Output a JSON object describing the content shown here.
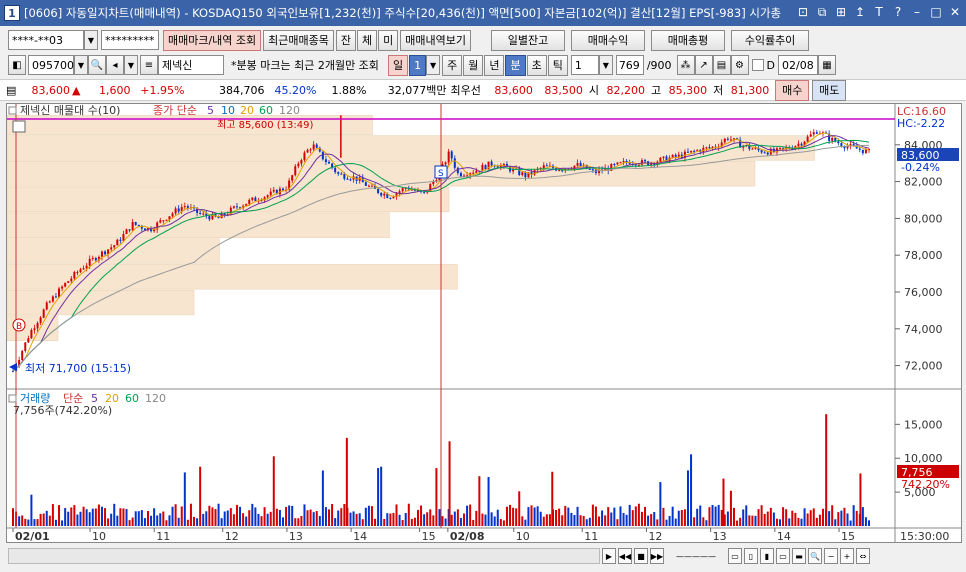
{
  "window": {
    "icon_label": "1",
    "title": "[0606] 자동일지차트(매매내역) - KOSDAQ150 외국인보유[1,232(천)] 주식수[20,436(천)] 액면[500] 자본금[102(억)] 결산[12월] EPS[-983] 시가총"
  },
  "toolbar1": {
    "account_value": "****-**03",
    "password_value": "*********",
    "trade_mark_btn": "매매마크/내역 조회",
    "recent_btn": "최근매매종목",
    "remain_btn": "잔",
    "exec_btn": "체",
    "pending_btn": "미",
    "history_btn": "매매내역보기",
    "daily_balance_btn": "일별잔고",
    "trade_profit_btn": "매매수익",
    "trade_eval_btn": "매매총평",
    "return_trend_btn": "수익률추이"
  },
  "toolbar2": {
    "code_value": "095700",
    "stock_name": "제넥신",
    "note": "*분봉 마크는 최근 2개월만 조회",
    "period_day": "일",
    "period_num": "1",
    "period_week": "주",
    "period_month": "월",
    "period_year": "년",
    "period_min": "분",
    "period_sec": "초",
    "period_tick": "틱",
    "interval_value": "1",
    "count_value": "769",
    "count_total": "/900",
    "date_label": "D",
    "date_value": "02/08"
  },
  "quote": {
    "price": "83,600",
    "change": "1,600",
    "change_pct": "+1.95%",
    "volume": "384,706",
    "vol_ratio": "45.20%",
    "turnover": "1.88%",
    "amount": "32,077백만",
    "best_label": "최우선",
    "ask": "83,600",
    "bid": "83,500",
    "open_label": "시",
    "open": "82,200",
    "high_label": "고",
    "high": "85,300",
    "low_label": "저",
    "low": "81,300",
    "buy_btn": "매수",
    "sell_btn": "매도"
  },
  "price_panel": {
    "legend_title": "제넥신 매물대 수(10)",
    "legend_ma": "종가 단순",
    "ma_periods": [
      "5",
      "10",
      "20",
      "60",
      "120"
    ],
    "high_annotation": "최고 85,600 (13:49)",
    "low_annotation": "최저 71,700 (15:15)",
    "lc_label": "LC:16.60",
    "hc_label": "HC:-2.22",
    "current_price": "83,600",
    "current_pct": "-0.24%",
    "y_ticks": [
      "84,000",
      "82,000",
      "80,000",
      "78,000",
      "76,000",
      "74,000",
      "72,000"
    ]
  },
  "volume_panel": {
    "legend_title": "거래량",
    "legend_ma": "단순",
    "ma_periods": [
      "5",
      "20",
      "60",
      "120"
    ],
    "volume_note": "7,756주(742.20%)",
    "current_volume": "7,756",
    "current_pct": "742.20%",
    "y_ticks": [
      "15,000",
      "10,000",
      "5,000"
    ]
  },
  "x_axis": {
    "labels": [
      "02/01",
      "10",
      "11",
      "12",
      "13",
      "14",
      "15",
      "02/08",
      "10",
      "11",
      "12",
      "13",
      "14",
      "15"
    ],
    "time_label": "15:30:00"
  },
  "colors": {
    "up": "#d40000",
    "down": "#0033cc",
    "volume_profile": "#f7e5d0",
    "high_line": "#cc00cc",
    "marker": "#cc0000"
  },
  "chart_data": {
    "type": "candlestick",
    "title": "제넥신 매물대 수(10)",
    "price_range": [
      71000,
      86000
    ],
    "high": 85600,
    "low": 71700,
    "close": 83600,
    "volume_profile_buckets": [
      {
        "price_low": 84500,
        "price_high": 85600,
        "relative": 0.43
      },
      {
        "price_low": 83100,
        "price_high": 84500,
        "relative": 0.95
      },
      {
        "price_low": 81700,
        "price_high": 83100,
        "relative": 0.88
      },
      {
        "price_low": 80300,
        "price_high": 81700,
        "relative": 0.52
      },
      {
        "price_low": 78900,
        "price_high": 80300,
        "relative": 0.45
      },
      {
        "price_low": 77500,
        "price_high": 78900,
        "relative": 0.25
      },
      {
        "price_low": 76100,
        "price_high": 77500,
        "relative": 0.53
      },
      {
        "price_low": 74700,
        "price_high": 76100,
        "relative": 0.22
      },
      {
        "price_low": 73300,
        "price_high": 74700,
        "relative": 0.06
      }
    ],
    "price_series": [
      [
        0,
        71700
      ],
      [
        0.02,
        73800
      ],
      [
        0.04,
        75300
      ],
      [
        0.06,
        76400
      ],
      [
        0.08,
        77300
      ],
      [
        0.1,
        78000
      ],
      [
        0.12,
        78600
      ],
      [
        0.14,
        79700
      ],
      [
        0.16,
        79400
      ],
      [
        0.18,
        80100
      ],
      [
        0.2,
        80700
      ],
      [
        0.22,
        80200
      ],
      [
        0.24,
        80000
      ],
      [
        0.26,
        80600
      ],
      [
        0.28,
        81000
      ],
      [
        0.3,
        81300
      ],
      [
        0.32,
        81700
      ],
      [
        0.335,
        83200
      ],
      [
        0.35,
        84000
      ],
      [
        0.36,
        83400
      ],
      [
        0.38,
        82400
      ],
      [
        0.4,
        82200
      ],
      [
        0.42,
        81600
      ],
      [
        0.44,
        81200
      ],
      [
        0.46,
        81700
      ],
      [
        0.48,
        81300
      ],
      [
        0.5,
        82600
      ],
      [
        0.51,
        83600
      ],
      [
        0.52,
        82400
      ],
      [
        0.54,
        82600
      ],
      [
        0.56,
        83000
      ],
      [
        0.58,
        82700
      ],
      [
        0.6,
        82300
      ],
      [
        0.62,
        82800
      ],
      [
        0.64,
        82700
      ],
      [
        0.66,
        82900
      ],
      [
        0.68,
        82500
      ],
      [
        0.7,
        82800
      ],
      [
        0.72,
        83100
      ],
      [
        0.74,
        83000
      ],
      [
        0.76,
        83200
      ],
      [
        0.78,
        83400
      ],
      [
        0.8,
        83700
      ],
      [
        0.82,
        83900
      ],
      [
        0.835,
        84400
      ],
      [
        0.85,
        84000
      ],
      [
        0.87,
        83700
      ],
      [
        0.89,
        83600
      ],
      [
        0.91,
        83900
      ],
      [
        0.92,
        84100
      ],
      [
        0.94,
        84800
      ],
      [
        0.955,
        84300
      ],
      [
        0.97,
        84000
      ],
      [
        0.985,
        83800
      ],
      [
        1.0,
        83600
      ]
    ]
  }
}
